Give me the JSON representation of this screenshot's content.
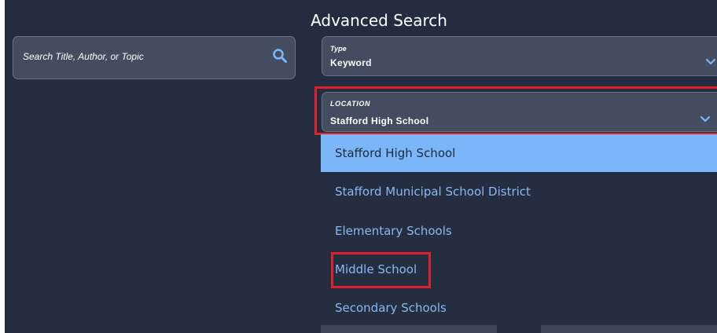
{
  "page": {
    "title": "Advanced Search"
  },
  "search": {
    "placeholder": "Search Title, Author, or Topic",
    "value": "",
    "icon": "search-icon"
  },
  "type_select": {
    "label": "Type",
    "value": "Keyword",
    "icon": "chevron-down-icon"
  },
  "location_select": {
    "label": "LOCATION",
    "value": "Stafford High School",
    "icon": "chevron-down-icon",
    "expanded": true,
    "options": [
      {
        "label": "Stafford High School",
        "selected": true
      },
      {
        "label": "Stafford Municipal School District",
        "selected": false
      },
      {
        "label": "Elementary Schools",
        "selected": false
      },
      {
        "label": "Middle School",
        "selected": false
      },
      {
        "label": "Secondary Schools",
        "selected": false
      }
    ]
  },
  "colors": {
    "background": "#232d3f",
    "field_background": "#434d5f",
    "field_border": "#6b7484",
    "accent": "#7ab6f8",
    "option_text": "#8ab8f2",
    "annotation_red": "#e0202a"
  }
}
